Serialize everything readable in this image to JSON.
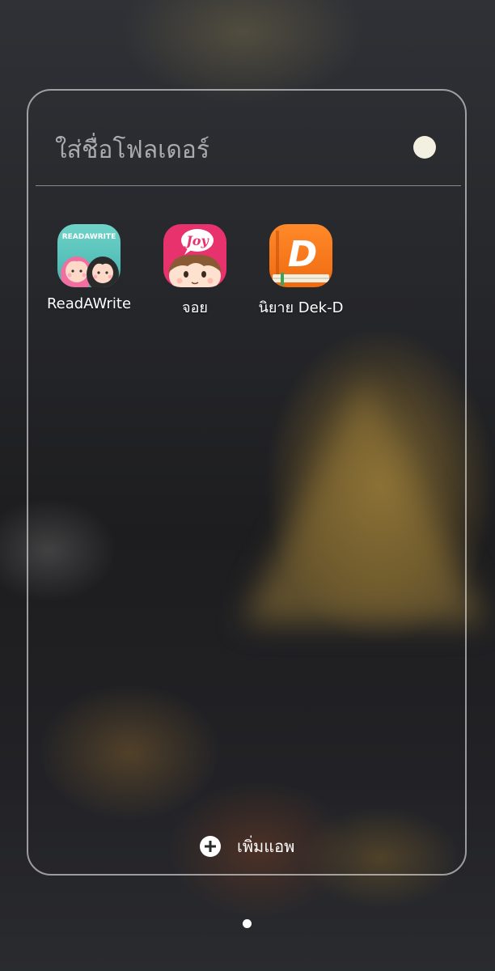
{
  "folder": {
    "name_placeholder": "ใส่ชื่อโฟลเดอร์",
    "color_dot": "#f3f0e2"
  },
  "apps": [
    {
      "label": "ReadAWrite",
      "icon": "readawrite-app-icon"
    },
    {
      "label": "จอย",
      "icon": "joy-app-icon",
      "icon_text": "Joy"
    },
    {
      "label": "นิยาย Dek-D",
      "icon": "dekd-app-icon",
      "icon_text": "D"
    }
  ],
  "add_apps": {
    "label": "เพิ่มแอพ",
    "icon": "plus-circle-icon"
  },
  "page_indicator": {
    "pages": 1,
    "current": 1
  }
}
